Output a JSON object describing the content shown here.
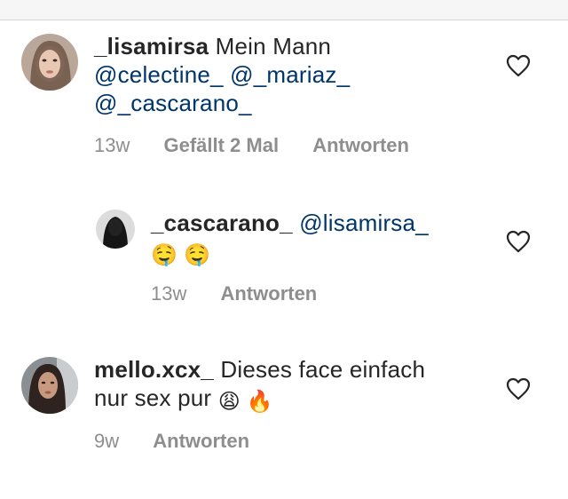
{
  "comments": [
    {
      "username": "_lisamirsa",
      "text": "Mein Mann",
      "mentions": [
        "@celectine_",
        "@_mariaz_",
        "@_cascarano_"
      ],
      "time": "13w",
      "likes": "Gefällt 2 Mal",
      "reply": "Antworten",
      "avatar_icon": "avatar-photo"
    },
    {
      "username": "_cascarano_",
      "mention": "@lisamirsa_",
      "emojis": "🤤 🤤",
      "time": "13w",
      "reply": "Antworten",
      "avatar_icon": "avatar-silhouette"
    },
    {
      "username": "mello.xcx_",
      "text_line1": "Dieses face einfach",
      "text_line2": "nur sex pur",
      "emojis": "😩 🔥",
      "time": "9w",
      "reply": "Antworten",
      "avatar_icon": "avatar-photo"
    }
  ],
  "icons": {
    "like": "heart-outline-icon"
  },
  "colors": {
    "mention": "#003569",
    "meta": "#8e8e8e",
    "text": "#262626"
  }
}
